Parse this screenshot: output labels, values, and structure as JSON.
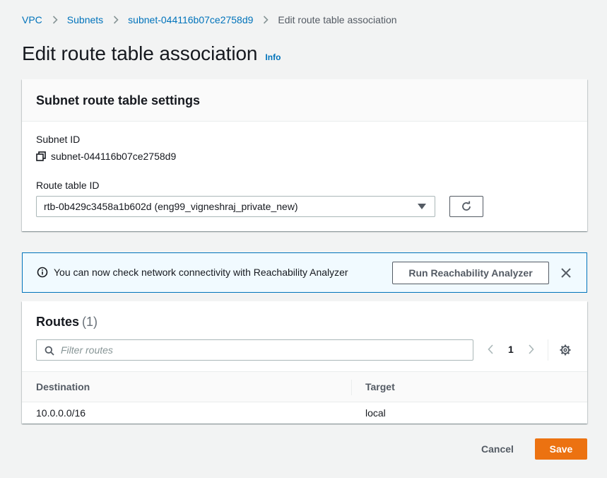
{
  "breadcrumb": {
    "items": [
      "VPC",
      "Subnets",
      "subnet-044116b07ce2758d9"
    ],
    "current": "Edit route table association"
  },
  "page": {
    "title": "Edit route table association",
    "info_label": "Info"
  },
  "settings": {
    "header": "Subnet route table settings",
    "subnet_id_label": "Subnet ID",
    "subnet_id_value": "subnet-044116b07ce2758d9",
    "route_table_label": "Route table ID",
    "route_table_value": "rtb-0b429c3458a1b602d (eng99_vigneshraj_private_new)"
  },
  "alert": {
    "text": "You can now check network connectivity with Reachability Analyzer",
    "button_label": "Run Reachability Analyzer"
  },
  "routes": {
    "title": "Routes",
    "count": "(1)",
    "filter_placeholder": "Filter routes",
    "page": "1",
    "columns": [
      "Destination",
      "Target"
    ],
    "rows": [
      {
        "destination": "10.0.0.0/16",
        "target": "local"
      }
    ]
  },
  "footer": {
    "cancel_label": "Cancel",
    "save_label": "Save"
  },
  "colors": {
    "link": "#0073bb",
    "primary_button": "#ec7211",
    "alert_background": "#f1faff",
    "alert_border": "#0073bb"
  }
}
